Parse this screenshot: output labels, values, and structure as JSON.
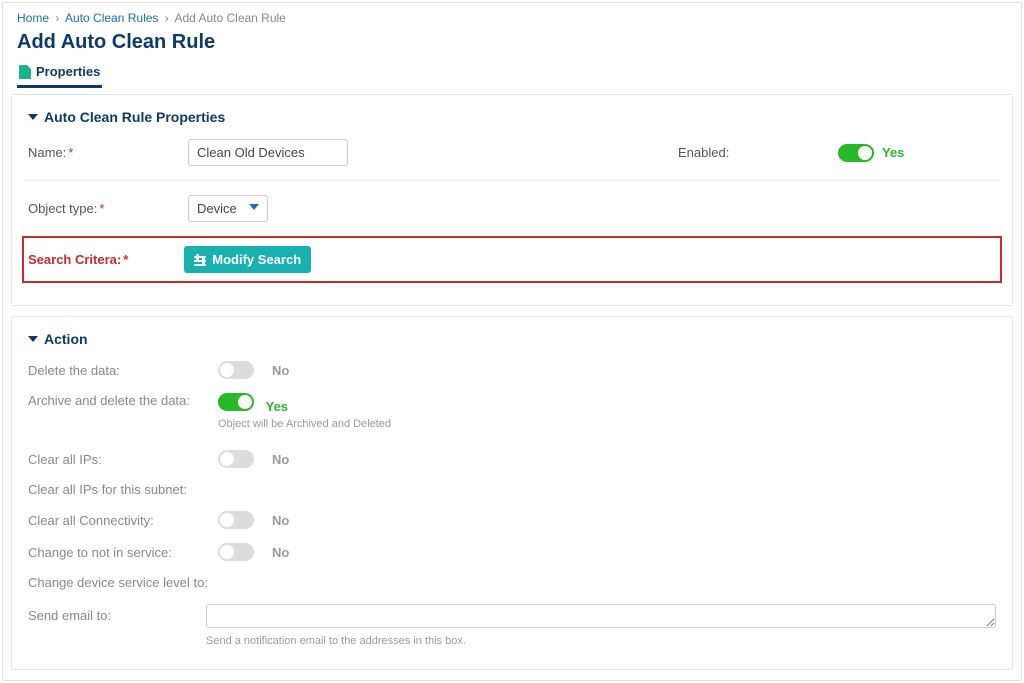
{
  "breadcrumb": {
    "home": "Home",
    "rules": "Auto Clean Rules",
    "current": "Add Auto Clean Rule"
  },
  "page_title": "Add Auto Clean Rule",
  "tabs": {
    "properties": "Properties"
  },
  "panel1": {
    "title": "Auto Clean Rule Properties",
    "name_label": "Name:",
    "name_value": "Clean Old Devices",
    "enabled_label": "Enabled:",
    "enabled_value": "Yes",
    "object_type_label": "Object type:",
    "object_type_value": "Device",
    "search_criteria_label": "Search Critera:",
    "modify_search_label": "Modify Search"
  },
  "panel2": {
    "title": "Action",
    "rows": {
      "delete_data": {
        "label": "Delete the data:",
        "value": "No"
      },
      "archive_delete": {
        "label": "Archive and delete the data:",
        "value": "Yes",
        "hint": "Object will be Archived and Deleted"
      },
      "clear_ips": {
        "label": "Clear all IPs:",
        "value": "No"
      },
      "clear_ips_subnet": {
        "label": "Clear all IPs for this subnet:"
      },
      "clear_connectivity": {
        "label": "Clear all Connectivity:",
        "value": "No"
      },
      "not_in_service": {
        "label": "Change to not in service:",
        "value": "No"
      },
      "service_level": {
        "label": "Change device service level to:"
      },
      "send_email": {
        "label": "Send email to:",
        "hint": "Send a notification email to the addresses in this box."
      }
    }
  }
}
